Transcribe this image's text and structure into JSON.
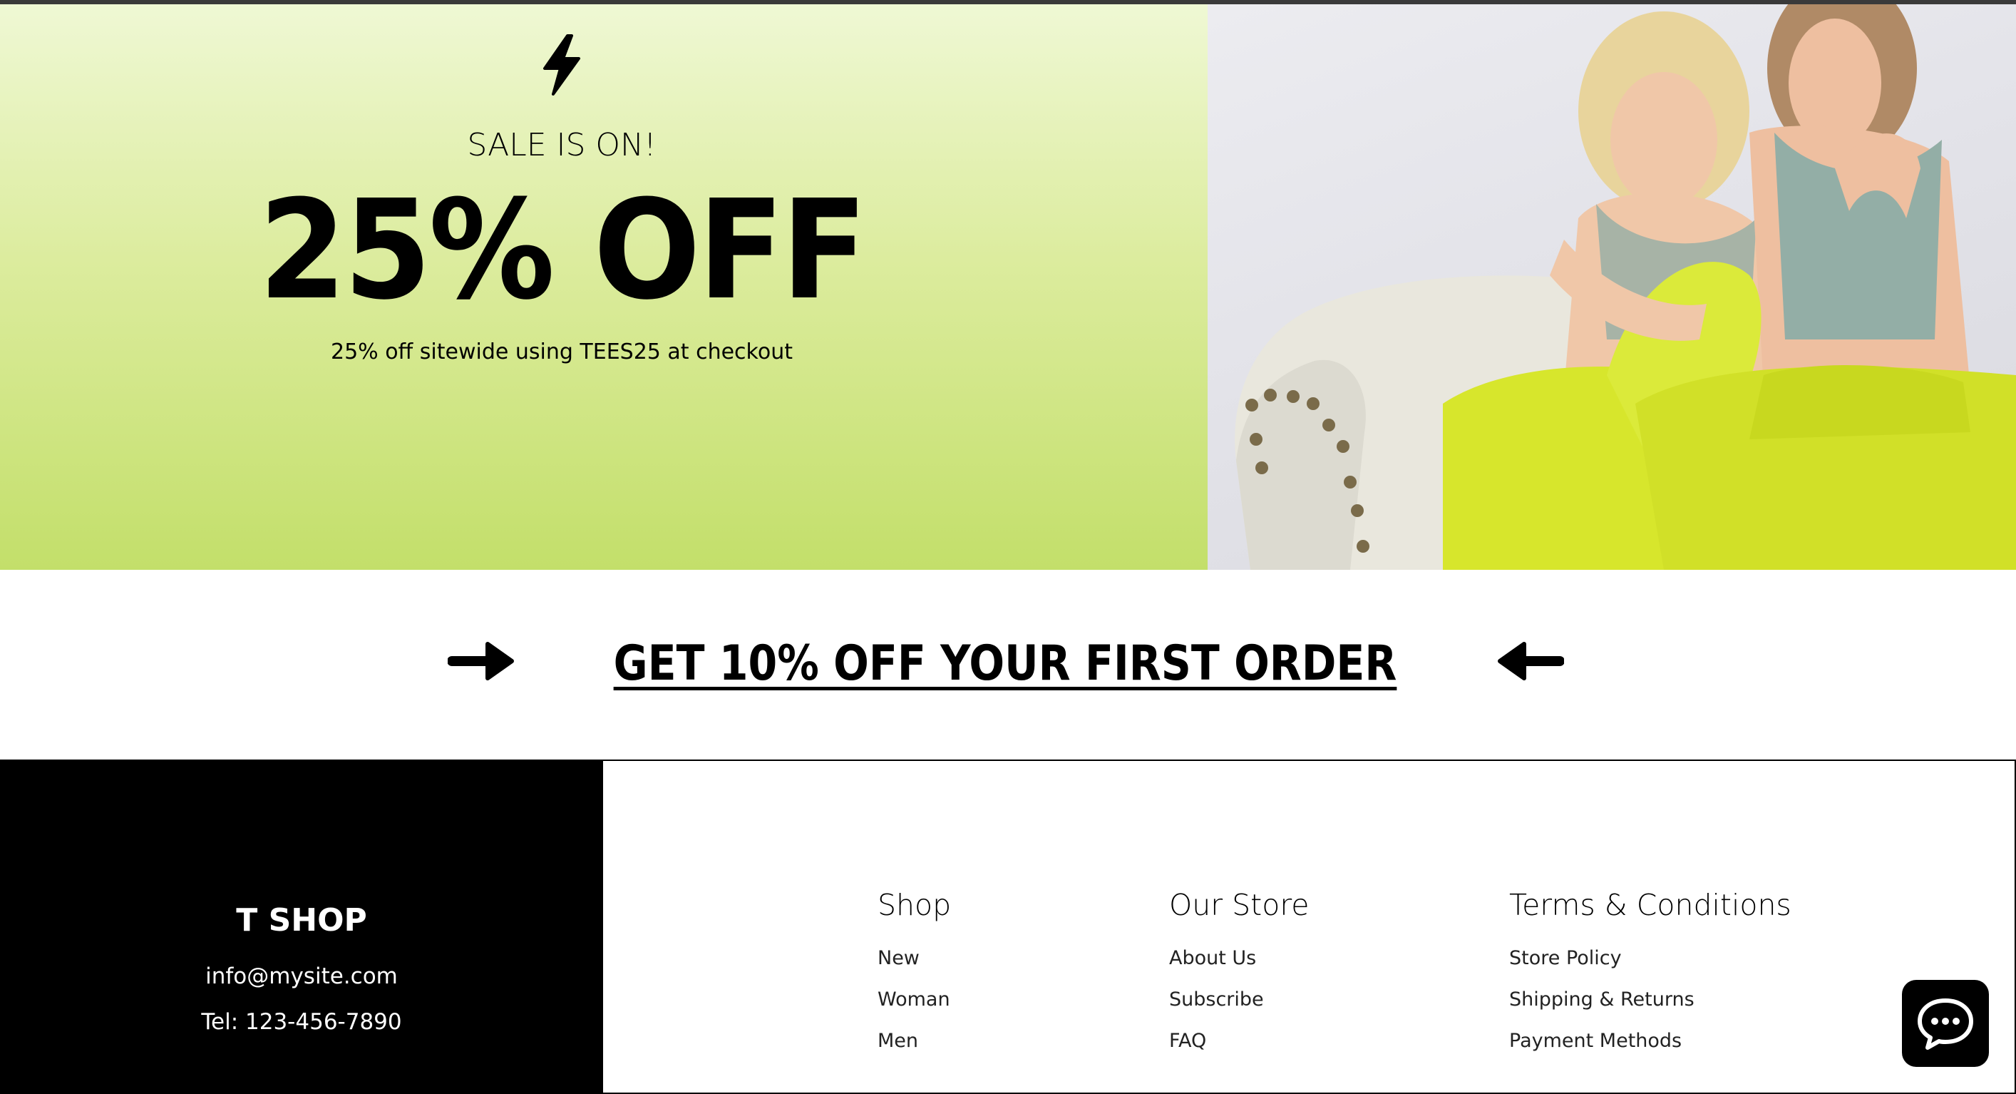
{
  "hero": {
    "kicker": "SALE IS ON!",
    "headline": "25% OFF",
    "subtext": "25% off sitewide using TEES25 at checkout",
    "icon": "lightning-bolt-icon",
    "photo_icon": "models-in-neon-pants-photo"
  },
  "promo": {
    "link_text": "GET 10% OFF YOUR FIRST ORDER",
    "left_icon": "arrow-right-icon",
    "right_icon": "arrow-left-icon"
  },
  "footer": {
    "brand": {
      "name": "T SHOP",
      "email": "info@mysite.com",
      "tel": "Tel: 123-456-7890"
    },
    "columns": {
      "shop": {
        "heading": "Shop",
        "items": [
          "New",
          "Woman",
          "Men"
        ]
      },
      "store": {
        "heading": "Our Store",
        "items": [
          "About Us",
          "Subscribe",
          "FAQ"
        ]
      },
      "terms": {
        "heading": "Terms & Conditions",
        "items": [
          "Store Policy",
          "Shipping & Returns",
          "Payment Methods"
        ]
      }
    }
  },
  "chat": {
    "icon": "chat-bubble-icon"
  },
  "colors": {
    "sale_bg_top": "#eff8d4",
    "sale_bg_bottom": "#c3df6a",
    "neon": "#d7e62c",
    "footer_dark": "#000000"
  }
}
